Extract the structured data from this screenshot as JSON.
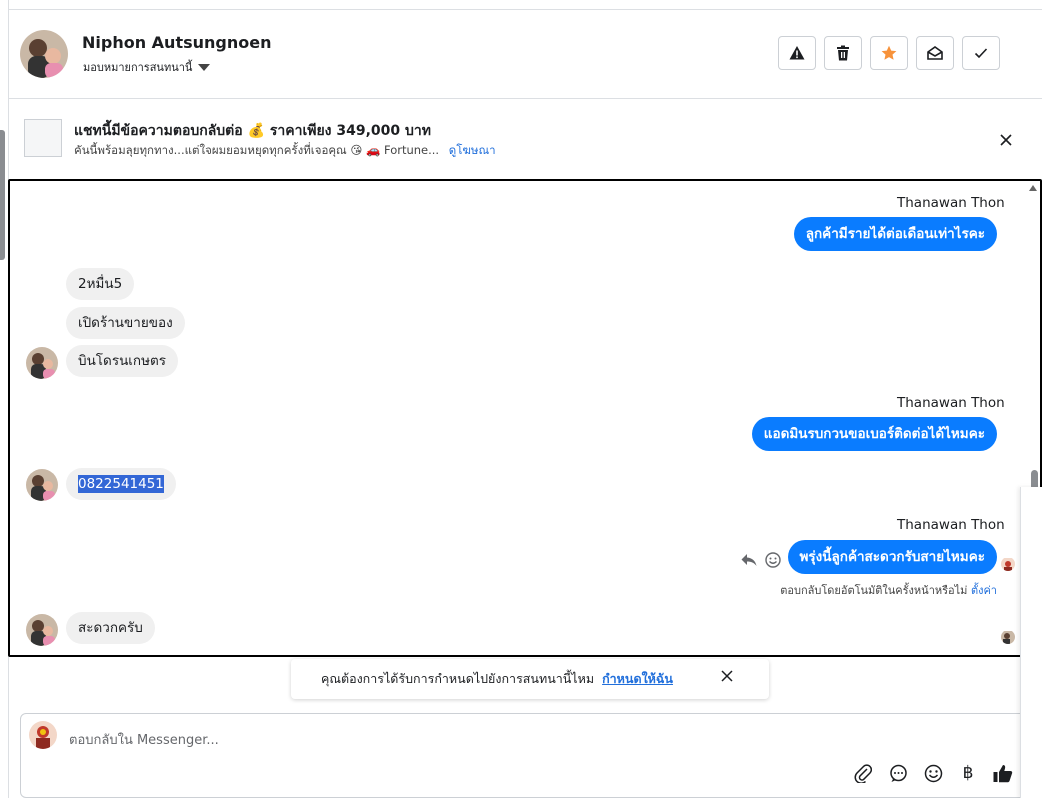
{
  "header": {
    "contact_name": "Niphon Autsungnoen",
    "assign_label": "มอบหมายการสนทนานี้",
    "actions": [
      "warning-icon",
      "trash-icon",
      "star-icon",
      "mark-unread-icon",
      "check-icon"
    ],
    "star_color": "#f7923a"
  },
  "ad": {
    "title": "แชทนี้มีข้อความตอบกลับต่อ 💰 ราคาเพียง 349,000 บาท",
    "subtitle": "คันนี้พร้อมลุยทุกทาง...แต่ใจผมยอมหยุดทุกครั้งที่เจอคุณ 😘 🚗 Fortune...",
    "link": "ดูโฆษณา"
  },
  "messages": {
    "sender1": "Thanawan Thon",
    "out1": "ลูกค้ามีรายได้ต่อเดือนเท่าไรคะ",
    "in1": "2หมื่น5",
    "in2": "เปิดร้านขายของ",
    "in3": "บินโดรนเกษตร",
    "sender2": "Thanawan Thon",
    "out2": "แอดมินรบกวนขอเบอร์ติดต่อได้ไหมคะ",
    "in4": "0822541451",
    "sender3": "Thanawan Thon",
    "out3": "พรุ่งนี้ลูกค้าสะดวกรับสายไหมคะ",
    "auto_note": "ตอบกลับโดยอัตโนมัติในครั้งหน้าหรือไม่",
    "auto_link": "ตั้งค่า",
    "in5": "สะดวกครับ",
    "bubble_color": "#0a7cff"
  },
  "toast": {
    "text": "คุณต้องการได้รับการกำหนดไปยังการสนทนานี้ไหม",
    "link": "กำหนดให้ฉัน"
  },
  "composer": {
    "placeholder": "ตอบกลับใน Messenger...",
    "tools": [
      "attach-icon",
      "chat-bubble-icon",
      "emoji-icon",
      "baht-icon",
      "like-icon"
    ]
  }
}
